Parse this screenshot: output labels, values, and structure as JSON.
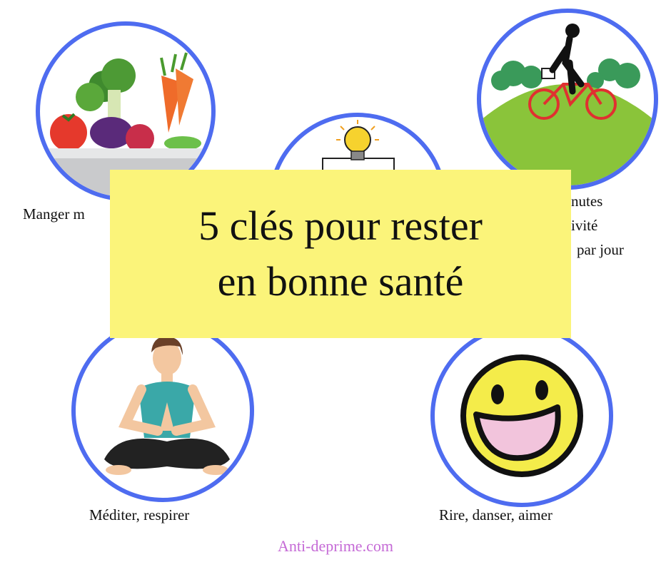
{
  "banner": {
    "line1": "5 clés pour rester",
    "line2": "en bonne santé"
  },
  "items": [
    {
      "label": "Manger m",
      "icon": "vegetables-bowl-icon"
    },
    {
      "label": "",
      "icon": "lightbulb-icon"
    },
    {
      "label_lines": [
        "nutes",
        "ivité",
        "par jour"
      ],
      "icon": "cyclist-icon"
    },
    {
      "label": "Méditer, respirer",
      "icon": "meditation-icon"
    },
    {
      "label": "Rire, danser, aimer",
      "icon": "smiley-icon"
    }
  ],
  "footer": "Anti-deprime.com",
  "colors": {
    "circle_border": "#4e6cf0",
    "banner": "#fbf47a",
    "footer_text": "#c56ad6"
  }
}
